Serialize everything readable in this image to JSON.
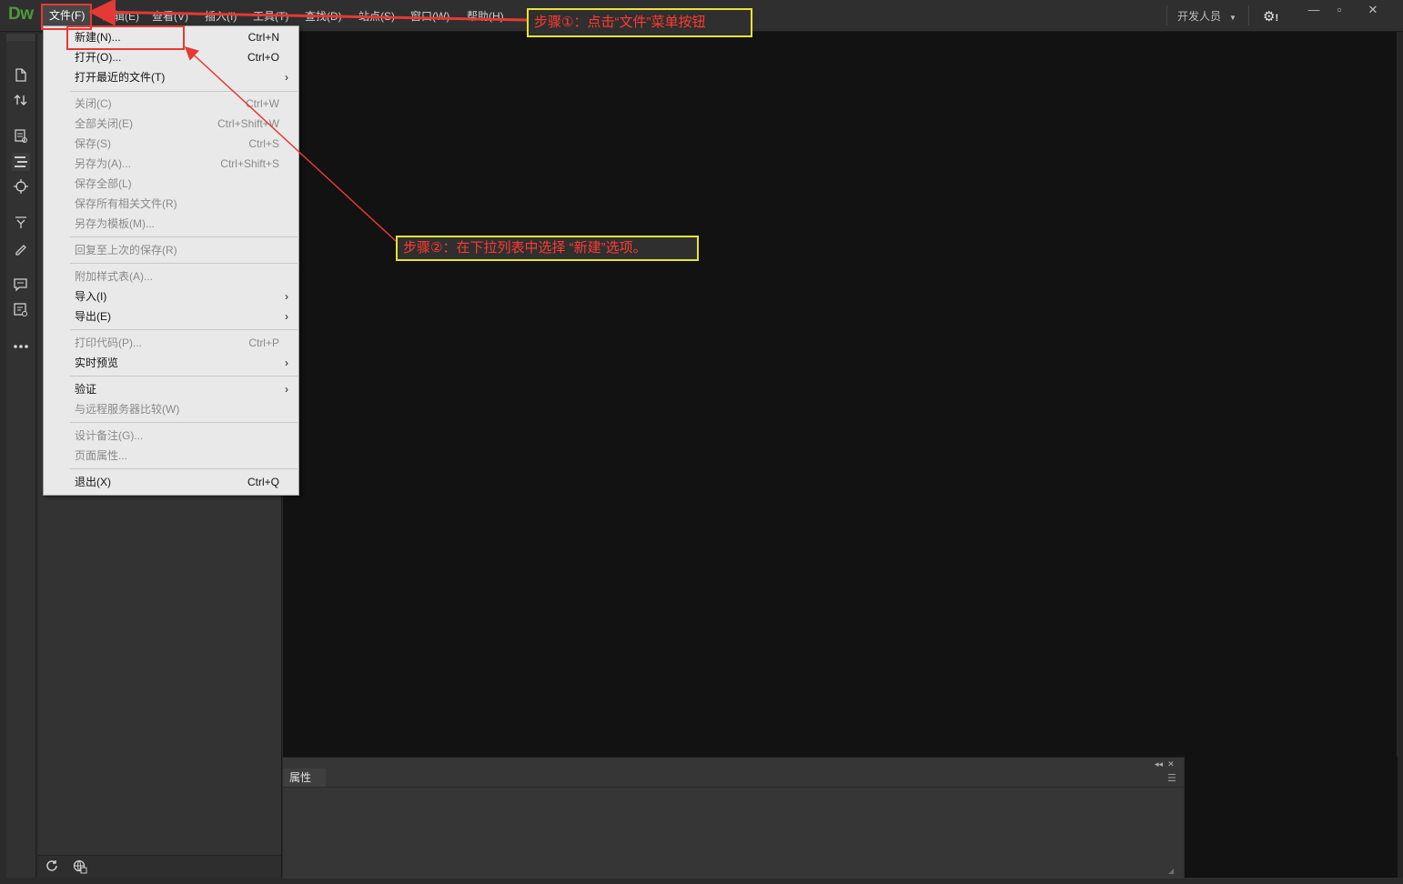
{
  "app": {
    "logo": "Dw",
    "menus": [
      "文件(F)",
      "编辑(E)",
      "查看(V)",
      "插入(I)",
      "工具(T)",
      "查找(D)",
      "站点(S)",
      "窗口(W)",
      "帮助(H)"
    ],
    "workspace": "开发人员",
    "gear_label": "!",
    "window_controls": [
      "minimize-icon",
      "maximize-icon",
      "close-icon"
    ]
  },
  "toolbar_icons": [
    "new-file-icon",
    "file-transfer-icon",
    "live-view-icon",
    "dom-tree-icon",
    "inspect-icon",
    "expand-icon",
    "format-icon",
    "comment-icon",
    "code-hint-icon",
    "more-icon"
  ],
  "left_panel": {
    "footer_icons": [
      "refresh-icon",
      "globe-icon"
    ]
  },
  "file_menu": {
    "items": [
      {
        "label": "新建(N)...",
        "shortcut": "Ctrl+N",
        "enabled": true
      },
      {
        "label": "打开(O)...",
        "shortcut": "Ctrl+O",
        "enabled": true
      },
      {
        "label": "打开最近的文件(T)",
        "shortcut": "",
        "enabled": true,
        "submenu": true
      },
      {
        "label": "关闭(C)",
        "shortcut": "Ctrl+W",
        "enabled": false
      },
      {
        "label": "全部关闭(E)",
        "shortcut": "Ctrl+Shift+W",
        "enabled": false
      },
      {
        "label": "保存(S)",
        "shortcut": "Ctrl+S",
        "enabled": false
      },
      {
        "label": "另存为(A)...",
        "shortcut": "Ctrl+Shift+S",
        "enabled": false
      },
      {
        "label": "保存全部(L)",
        "shortcut": "",
        "enabled": false
      },
      {
        "label": "保存所有相关文件(R)",
        "shortcut": "",
        "enabled": false
      },
      {
        "label": "另存为模板(M)...",
        "shortcut": "",
        "enabled": false
      },
      {
        "label": "回复至上次的保存(R)",
        "shortcut": "",
        "enabled": false
      },
      {
        "label": "附加样式表(A)...",
        "shortcut": "",
        "enabled": false
      },
      {
        "label": "导入(I)",
        "shortcut": "",
        "enabled": true,
        "submenu": true
      },
      {
        "label": "导出(E)",
        "shortcut": "",
        "enabled": true,
        "submenu": true
      },
      {
        "label": "打印代码(P)...",
        "shortcut": "Ctrl+P",
        "enabled": false
      },
      {
        "label": "实时预览",
        "shortcut": "",
        "enabled": true,
        "submenu": true
      },
      {
        "label": "验证",
        "shortcut": "",
        "enabled": true,
        "submenu": true
      },
      {
        "label": "与远程服务器比较(W)",
        "shortcut": "",
        "enabled": false
      },
      {
        "label": "设计备注(G)...",
        "shortcut": "",
        "enabled": false
      },
      {
        "label": "页面属性...",
        "shortcut": "",
        "enabled": false
      },
      {
        "label": "退出(X)",
        "shortcut": "Ctrl+Q",
        "enabled": true
      }
    ],
    "submenu_arrow": "›"
  },
  "properties_panel": {
    "tab": "属性"
  },
  "annotations": {
    "step1": "步骤①：点击“文件”菜单按钮",
    "step2": "步骤②：在下拉列表中选择 “新建”选项。"
  },
  "colors": {
    "annotation_text": "#ff3b30",
    "annotation_border": "#e8e33a",
    "highlight": "#e53935",
    "logo": "#4f9a3a"
  }
}
